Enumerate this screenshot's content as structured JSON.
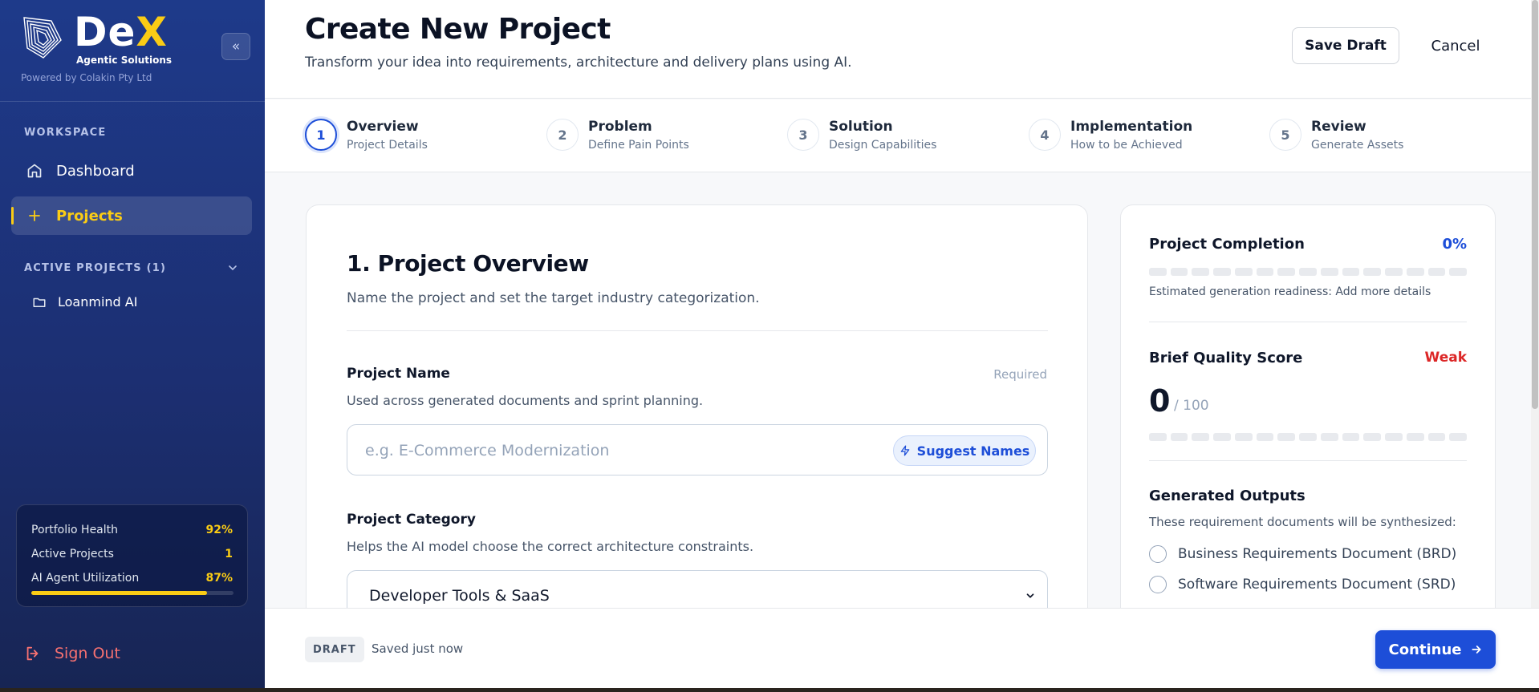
{
  "brand": {
    "name_main": "De",
    "name_accent": "X",
    "tagline": "Agentic Solutions",
    "powered_by": "Powered by Colakin Pty Ltd"
  },
  "sidebar": {
    "collapse_icon": "«",
    "workspace_label": "WORKSPACE",
    "nav": [
      {
        "label": "Dashboard",
        "icon": "home-icon"
      },
      {
        "label": "Projects",
        "icon": "plus-icon",
        "active": true
      }
    ],
    "active_projects_label": "ACTIVE PROJECTS (1)",
    "projects": [
      {
        "label": "Loanmind AI",
        "icon": "folder-icon"
      }
    ],
    "stats": [
      {
        "label": "Portfolio Health",
        "value": "92%"
      },
      {
        "label": "Active Projects",
        "value": "1"
      },
      {
        "label": "AI Agent Utilization",
        "value": "87%"
      }
    ],
    "utilization_fraction": 0.87,
    "sign_out": "Sign Out"
  },
  "header": {
    "title": "Create New Project",
    "subtitle": "Transform your idea into requirements, architecture and delivery plans using AI.",
    "save_draft": "Save Draft",
    "cancel": "Cancel"
  },
  "steps": [
    {
      "num": "1",
      "title": "Overview",
      "sub": "Project Details",
      "active": true
    },
    {
      "num": "2",
      "title": "Problem",
      "sub": "Define Pain Points"
    },
    {
      "num": "3",
      "title": "Solution",
      "sub": "Design Capabilities"
    },
    {
      "num": "4",
      "title": "Implementation",
      "sub": "How to be Achieved"
    },
    {
      "num": "5",
      "title": "Review",
      "sub": "Generate Assets"
    }
  ],
  "form": {
    "title": "1. Project Overview",
    "description": "Name the project and set the target industry categorization.",
    "project_name": {
      "label": "Project Name",
      "required": "Required",
      "help": "Used across generated documents and sprint planning.",
      "value": "",
      "placeholder": "e.g. E-Commerce Modernization",
      "suggest": "Suggest Names"
    },
    "project_category": {
      "label": "Project Category",
      "help": "Helps the AI model choose the correct architecture constraints.",
      "selected": "Developer Tools & SaaS"
    }
  },
  "side": {
    "completion_title": "Project Completion",
    "completion_pct": "0%",
    "completion_fraction": 0,
    "completion_note": "Estimated generation readiness: Add more details",
    "quality_title": "Brief Quality Score",
    "quality_label": "Weak",
    "quality_score": "0",
    "quality_max": "/ 100",
    "outputs_title": "Generated Outputs",
    "outputs_help": "These requirement documents will be synthesized:",
    "outputs": [
      "Business Requirements Document (BRD)",
      "Software Requirements Document (SRD)"
    ]
  },
  "footer": {
    "badge": "DRAFT",
    "saved": "Saved just now",
    "continue": "Continue"
  },
  "colors": {
    "accent": "#1d4ed8",
    "brand_yellow": "#facc15",
    "danger": "#dc2626",
    "sidebar": "#1e3a8a"
  }
}
